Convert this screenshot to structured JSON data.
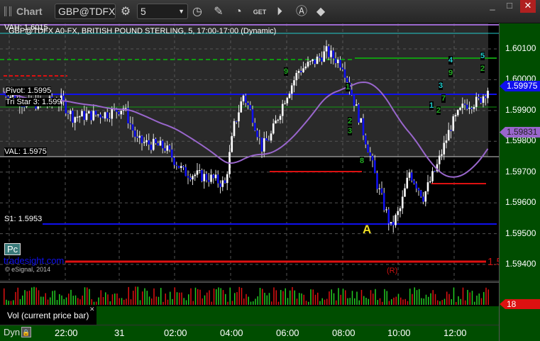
{
  "window": {
    "title": "Chart",
    "symbol": "GBP@TDFX",
    "interval": "5"
  },
  "chart": {
    "description": "GBP@TDFX A0-FX, BRITISH POUND STERLING, 5, 17:00-17:00 (Dynamic)",
    "vah_label": "VAH: 1.6015",
    "pivot_label": "Pivot: 1.5995",
    "tristar_label": "Tri Star 3: 1.599",
    "val_label": "VAL: 1.5975",
    "s1_label": "S1: 1.5953",
    "pc_label": "Pc",
    "watermark": "tradesight.com",
    "copyright": "© eSignal, 2014",
    "marker_a": "A",
    "marker_r": "(R)",
    "red_edge_label": "1.5",
    "counts": [
      {
        "t": "5",
        "c": "#22cccc"
      },
      {
        "t": "4",
        "c": "#22cccc"
      },
      {
        "t": "9",
        "c": "#22aa22"
      },
      {
        "t": "2",
        "c": "#22aa22"
      },
      {
        "t": "3",
        "c": "#22cccc"
      },
      {
        "t": "1",
        "c": "#22cccc"
      },
      {
        "t": "2",
        "c": "#22aa22"
      },
      {
        "t": "7",
        "c": "#22aa22"
      },
      {
        "t": "9",
        "c": "#22aa22"
      },
      {
        "t": "1",
        "c": "#22aa22"
      },
      {
        "t": "2",
        "c": "#22aa22"
      },
      {
        "t": "3",
        "c": "#22aa22"
      },
      {
        "t": "8",
        "c": "#22aa22"
      }
    ],
    "price_ticks": [
      "1.60100",
      "1.60000",
      "1.59900",
      "1.59800",
      "1.59700",
      "1.59600",
      "1.59500",
      "1.59400"
    ],
    "last_price": "1.59975",
    "ma_value": "1.59831",
    "price_path": [
      [
        0,
        1.5996
      ],
      [
        10,
        1.5992
      ],
      [
        25,
        1.5993
      ],
      [
        30,
        1.5988
      ],
      [
        45,
        1.5989
      ],
      [
        52,
        1.5991
      ],
      [
        58,
        1.598
      ],
      [
        70,
        1.5978
      ],
      [
        78,
        1.597
      ],
      [
        90,
        1.5968
      ],
      [
        96,
        1.5966
      ],
      [
        100,
        1.5985
      ],
      [
        104,
        1.5995
      ],
      [
        108,
        1.5988
      ],
      [
        112,
        1.5978
      ],
      [
        116,
        1.5982
      ],
      [
        122,
        1.5994
      ],
      [
        128,
        1.6003
      ],
      [
        135,
        1.6006
      ],
      [
        140,
        1.6009
      ],
      [
        147,
        1.6005
      ],
      [
        152,
        1.5993
      ],
      [
        158,
        1.5978
      ],
      [
        162,
        1.5966
      ],
      [
        168,
        1.5952
      ],
      [
        172,
        1.5958
      ],
      [
        176,
        1.597
      ],
      [
        182,
        1.5962
      ],
      [
        188,
        1.5972
      ],
      [
        194,
        1.5985
      ],
      [
        200,
        1.5992
      ],
      [
        206,
        1.5993
      ],
      [
        210,
        1.5997
      ]
    ]
  },
  "volume": {
    "label": "Vol (current price bar)",
    "value": "18"
  },
  "axis": {
    "dyn_label": "Dyn",
    "times": [
      "22:00",
      "31",
      "02:00",
      "04:00",
      "06:00",
      "08:00",
      "10:00",
      "12:00"
    ]
  },
  "colors": {
    "up": "#ffffff",
    "down": "#1010ee",
    "ma": "#9966cc",
    "vol_up": "#22cc22",
    "vol_down": "#dd1111"
  }
}
